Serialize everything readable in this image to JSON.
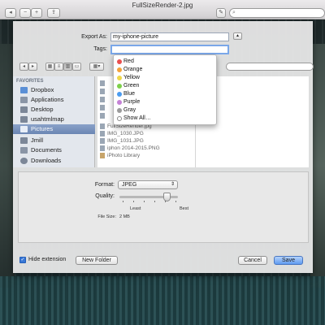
{
  "window": {
    "title": "FullSizeRender-2.jpg",
    "toolbar_icons": [
      "back-icon",
      "zoom-out-icon",
      "zoom-in-icon",
      "share-icon",
      "edit-icon"
    ],
    "search_placeholder": ""
  },
  "export_dialog": {
    "export_as_label": "Export As:",
    "export_as_value": "my-iphone-picture",
    "tags_label": "Tags:",
    "tags_value": ""
  },
  "tags_popup": {
    "items": [
      {
        "label": "Red",
        "color": "#ea4f4f"
      },
      {
        "label": "Orange",
        "color": "#f4a33b"
      },
      {
        "label": "Yellow",
        "color": "#efd84a"
      },
      {
        "label": "Green",
        "color": "#7ed04a"
      },
      {
        "label": "Blue",
        "color": "#4b9cf0"
      },
      {
        "label": "Purple",
        "color": "#c582d6"
      },
      {
        "label": "Gray",
        "color": "#9b9b9b"
      },
      {
        "label": "Show All…",
        "color": ""
      }
    ]
  },
  "sidebar": {
    "heading": "FAVORITES",
    "items": [
      {
        "label": "Dropbox",
        "icon": "dropbox-icon"
      },
      {
        "label": "Applications",
        "icon": "applications-icon"
      },
      {
        "label": "Desktop",
        "icon": "desktop-icon"
      },
      {
        "label": "usahtmlmap",
        "icon": "home-icon"
      },
      {
        "label": "Pictures",
        "icon": "pictures-icon",
        "selected": true
      },
      {
        "label": "Jmill",
        "icon": "home-icon"
      },
      {
        "label": "Documents",
        "icon": "documents-icon"
      },
      {
        "label": "Downloads",
        "icon": "downloads-icon"
      }
    ]
  },
  "files": [
    {
      "label": "FullSizeRender.jpg"
    },
    {
      "label": "IMG_1030.JPG"
    },
    {
      "label": "IMG_1031.JPG"
    },
    {
      "label": "iphon 2014-2015.PNG"
    },
    {
      "label": "iPhoto Library"
    }
  ],
  "options": {
    "format_label": "Format:",
    "format_value": "JPEG",
    "quality_label": "Quality:",
    "quality_value": 0.8,
    "least_label": "Least",
    "best_label": "Best",
    "file_size_label": "File Size:",
    "file_size_value": "2 MB"
  },
  "footer": {
    "hide_extension_label": "Hide extension",
    "hide_extension_checked": true,
    "new_folder_label": "New Folder",
    "cancel_label": "Cancel",
    "save_label": "Save"
  }
}
